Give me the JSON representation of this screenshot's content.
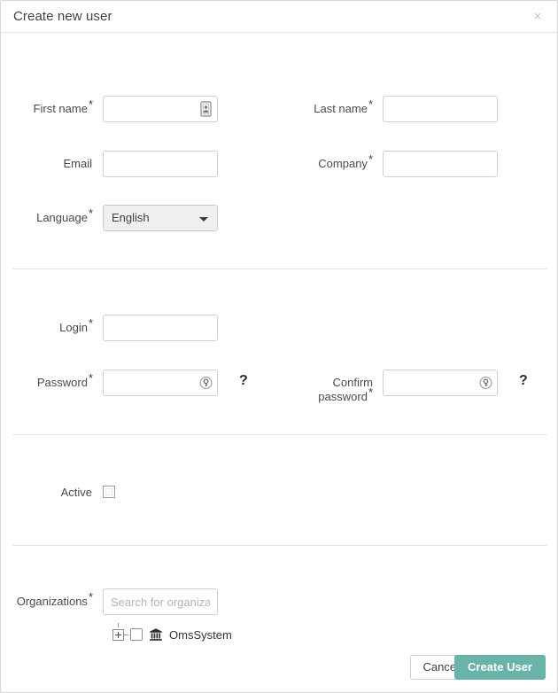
{
  "dialog": {
    "title": "Create new user",
    "close_label": "×"
  },
  "fields": {
    "first_name": {
      "label": "First name",
      "required": "*",
      "value": "",
      "placeholder": "",
      "icon": "contact-card-autofill-icon"
    },
    "last_name": {
      "label": "Last name",
      "required": "*",
      "value": "",
      "placeholder": ""
    },
    "email": {
      "label": "Email",
      "required": "",
      "value": "",
      "placeholder": ""
    },
    "company": {
      "label": "Company",
      "required": "*",
      "value": "",
      "placeholder": ""
    },
    "language": {
      "label": "Language",
      "required": "*",
      "selected": "English",
      "options": [
        "English"
      ],
      "icon": "chevron-down-icon"
    },
    "login": {
      "label": "Login",
      "required": "*",
      "value": "",
      "placeholder": ""
    },
    "password": {
      "label": "Password",
      "required": "*",
      "value": "",
      "placeholder": "",
      "icon": "key-icon",
      "help": "?"
    },
    "confirm_password": {
      "label_line1": "Confirm",
      "label_line2": "password",
      "required": "*",
      "value": "",
      "placeholder": "",
      "icon": "key-icon",
      "help": "?"
    },
    "active": {
      "label": "Active",
      "required": "",
      "checked": false
    },
    "organizations": {
      "label": "Organizations",
      "required": "*",
      "value": "",
      "placeholder": "Search for organizations",
      "tree": [
        {
          "label": "OmsSystem",
          "checked": false,
          "expanded": false,
          "toggle_icon": "expand-plus-icon",
          "node_icon": "institution-bank-icon"
        }
      ]
    }
  },
  "footer": {
    "cancel_label": "Cancel",
    "submit_label": "Create User"
  },
  "colors": {
    "primary": "#69b3ab",
    "border": "#cfcfcf",
    "divider": "#e4e4e4",
    "text": "#3a3a3a",
    "placeholder": "#b4b4b4"
  }
}
